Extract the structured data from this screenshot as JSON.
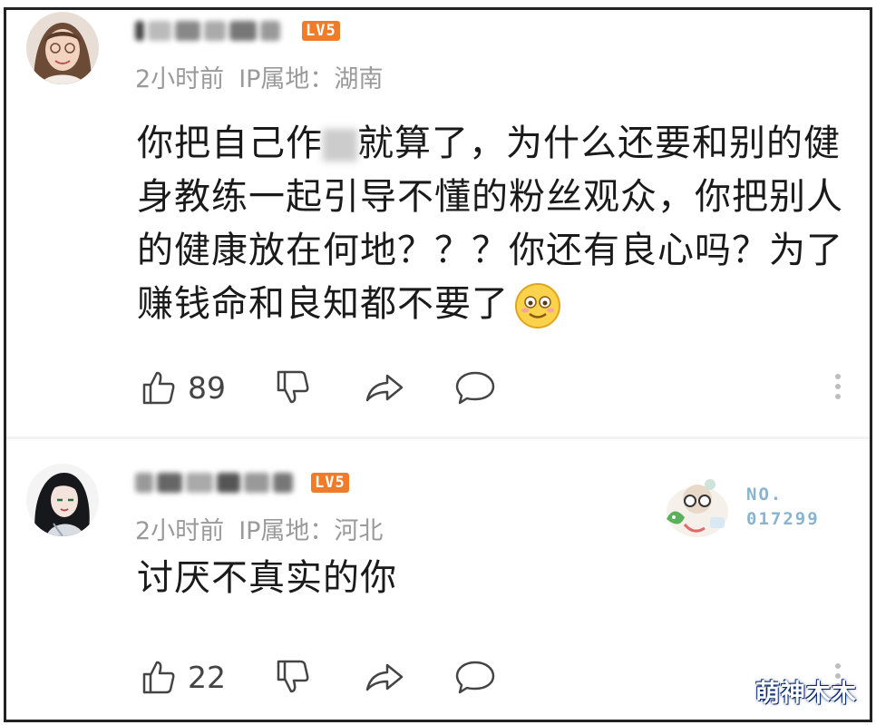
{
  "comments": [
    {
      "level": "LV5",
      "time": "2小时前",
      "ip_location": "IP属地：湖南",
      "content_lines": [
        "你把自己作",
        "身教练一起引导不懂的粉丝观众，你把别人",
        "的健康放在何地？？？你还有良心吗？为了",
        "赚钱命和良知都不要了"
      ],
      "content_line1_tail": "就算了，为什么还要和别的健",
      "emoji": "smiley-emoji",
      "likes": "89"
    },
    {
      "level": "LV5",
      "time": "2小时前",
      "ip_location": "IP属地：河北",
      "content_lines": [
        "讨厌不真实的你"
      ],
      "likes": "22",
      "fan_badge_number_label": "NO.",
      "fan_badge_number": "017299"
    }
  ],
  "watermark": "萌神木木",
  "colors": {
    "level_badge": "#f07c2a",
    "meta_text": "#9a9a9a",
    "body_text": "#1a1a1a",
    "badge_number": "#88b4cf"
  }
}
